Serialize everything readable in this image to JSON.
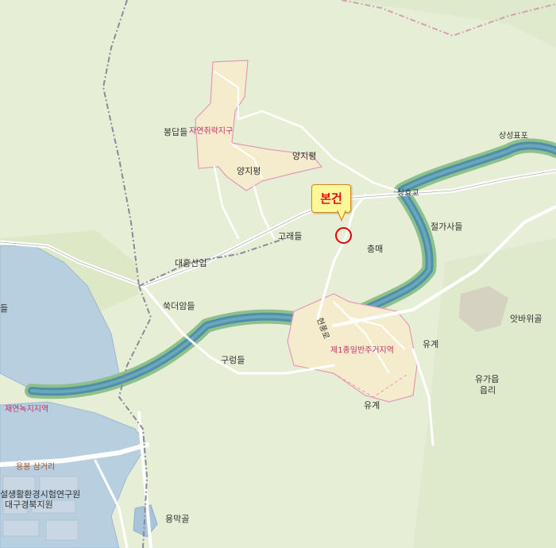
{
  "map": {
    "labels": {
      "bongdapdeul": "봉답들",
      "natural_village": "자연취락지구",
      "yangjipyeong_1": "양지평",
      "yangjipyeong_2": "양지평",
      "sanghyogyo": "상효교",
      "godaedeul": "고래들",
      "chungmae": "충매",
      "daeheung": "대흥산업",
      "ssukdeoamdeul": "쑥더암들",
      "gurungdeul": "구렁들",
      "mixed_residential": "제1종일반주거지역",
      "yugye_1": "유계",
      "yugye_2": "유계",
      "yugaeup": "유가읍",
      "eumni": "읍리",
      "jeolgasadeul": "절가사들",
      "atbawiwigol": "앗바위골",
      "sangseongpo": "상성표포",
      "natural_green": "재연녹지지역",
      "yongbong": "용봉 삼거리",
      "institute": "설생활환경시험연구원",
      "branch": "대구경북지원",
      "yongmakgol": "용막골",
      "left_edge": "들",
      "road_name": "현풍로"
    },
    "callout": {
      "text": "본건"
    },
    "colors": {
      "land": "#e6efd6",
      "river": "#4f8fa8",
      "river_bank": "#7fb87f",
      "lake": "#b8cfe0",
      "zone": "#f5eccd",
      "zone_border": "#e39ab8",
      "road": "#ffffff",
      "boundary": "#8a8a9a",
      "marker": "#e00000"
    }
  }
}
